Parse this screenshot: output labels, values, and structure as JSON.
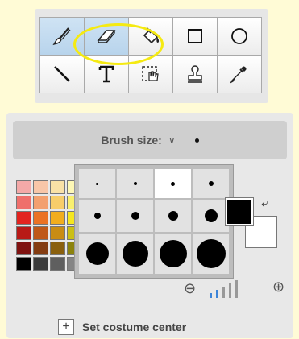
{
  "tools": [
    {
      "name": "paintbrush-tool",
      "icon": "paintbrush-icon",
      "selected": true
    },
    {
      "name": "eraser-tool",
      "icon": "eraser-icon",
      "selected": true
    },
    {
      "name": "fill-tool",
      "icon": "paint-bucket-icon",
      "selected": false
    },
    {
      "name": "rectangle-tool",
      "icon": "rectangle-icon",
      "selected": false
    },
    {
      "name": "ellipse-tool",
      "icon": "ellipse-icon",
      "selected": false
    },
    {
      "name": "line-tool",
      "icon": "line-icon",
      "selected": false
    },
    {
      "name": "text-tool",
      "icon": "text-icon",
      "selected": false
    },
    {
      "name": "select-tool",
      "icon": "select-hand-icon",
      "selected": false
    },
    {
      "name": "stamp-tool",
      "icon": "stamp-icon",
      "selected": false
    },
    {
      "name": "eyedropper-tool",
      "icon": "eyedropper-icon",
      "selected": false
    }
  ],
  "brush": {
    "label": "Brush size:",
    "dropdown_icon": "chevron-down-icon"
  },
  "brush_sizes": [
    {
      "size": 1,
      "active": false
    },
    {
      "size": 2,
      "active": false
    },
    {
      "size": 3,
      "active": true
    },
    {
      "size": 4,
      "active": false
    },
    {
      "size": 5,
      "active": false
    },
    {
      "size": 6,
      "active": false
    },
    {
      "size": 7,
      "active": false
    },
    {
      "size": 8,
      "active": false
    },
    {
      "size": 9,
      "active": false
    },
    {
      "size": 10,
      "active": false
    },
    {
      "size": 11,
      "active": false
    },
    {
      "size": 12,
      "active": false
    }
  ],
  "palette": [
    "#f4a9a8",
    "#f8c6a8",
    "#f9e1a6",
    "#fdf7b5",
    "#e4f2b2",
    "#c9ebd7",
    "#c5e0f0",
    "#d7ccee",
    "#f0c5e6",
    "#ef6f6b",
    "#f3a06e",
    "#f7cd6a",
    "#f9ef6e",
    "#c8e36f",
    "#89d1ae",
    "#85bde3",
    "#ab97dc",
    "#e08fcd",
    "#e2241f",
    "#ea7224",
    "#f1ad1d",
    "#f5e61f",
    "#9dc92a",
    "#2fb175",
    "#2c8dd2",
    "#6a45b8",
    "#cf3c9d",
    "#b81a17",
    "#bf5818",
    "#c98c14",
    "#cbbf15",
    "#7ba222",
    "#218b5c",
    "#1f6ea8",
    "#523590",
    "#a52c7c",
    "#7f1210",
    "#843c11",
    "#8a600e",
    "#8c830e",
    "#557018",
    "#175f3f",
    "#154b73",
    "#372463",
    "#721f55",
    "#000000",
    "#3b3b3b",
    "#5f5f5f",
    "#858585",
    "#a9a9a9",
    "#c8c8c8",
    "#e0e0e0",
    "#f2f2f2",
    "#ffffff"
  ],
  "colors": {
    "foreground": "#000000",
    "background": "#ffffff",
    "accent": "#3c84d8",
    "highlight_ring": "#f5ea12"
  },
  "color_controls": {
    "swap_icon": "swap-colors-icon"
  },
  "zoom": {
    "out_icon": "zoom-out-icon",
    "in_icon": "zoom-in-icon",
    "level": 2,
    "levels": 5
  },
  "costume_center": {
    "label": "Set costume center",
    "icon": "plus-icon"
  }
}
